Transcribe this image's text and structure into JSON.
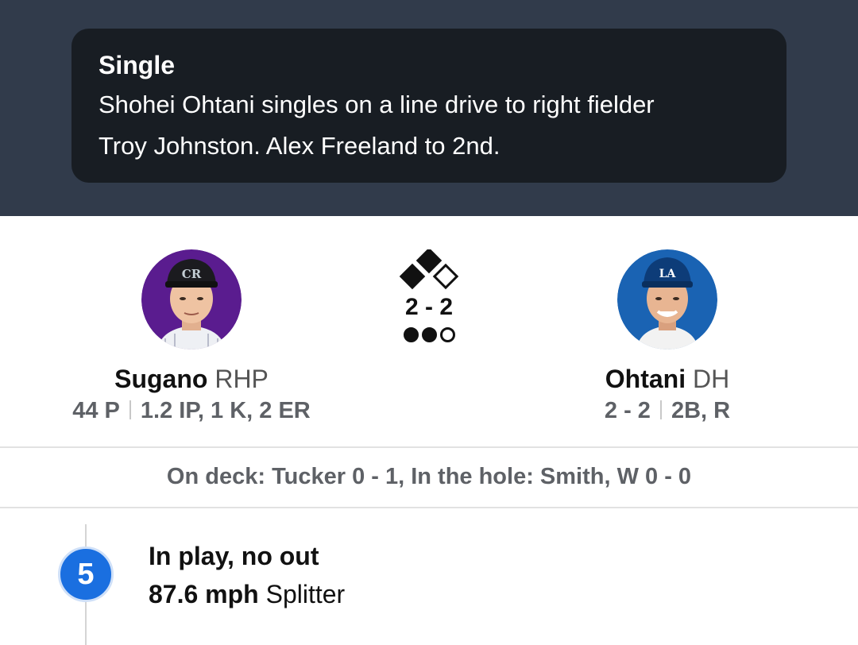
{
  "play": {
    "title": "Single",
    "description_line1": "Shohei Ohtani singles on a line drive to right fielder",
    "description_line2": "Troy Johnston. Alex Freeland to 2nd."
  },
  "pitcher": {
    "last_name": "Sugano",
    "position": "RHP",
    "pitches": "44 P",
    "line": "1.2 IP, 1 K, 2 ER",
    "team_color": "#33006f",
    "cap_logo": "CR"
  },
  "batter": {
    "last_name": "Ohtani",
    "position": "DH",
    "today": "2 - 2",
    "line": "2B, R",
    "team_color": "#005a9c",
    "cap_logo": "LA"
  },
  "situation": {
    "count": "2 - 2",
    "bases": {
      "first": false,
      "second": true,
      "third": true
    },
    "outs": 2
  },
  "on_deck_text": "On deck: Tucker 0 - 1, In the hole: Smith, W 0 - 0",
  "pitch": {
    "number": "5",
    "result": "In play, no out",
    "speed": "87.6 mph",
    "type": "Splitter"
  }
}
